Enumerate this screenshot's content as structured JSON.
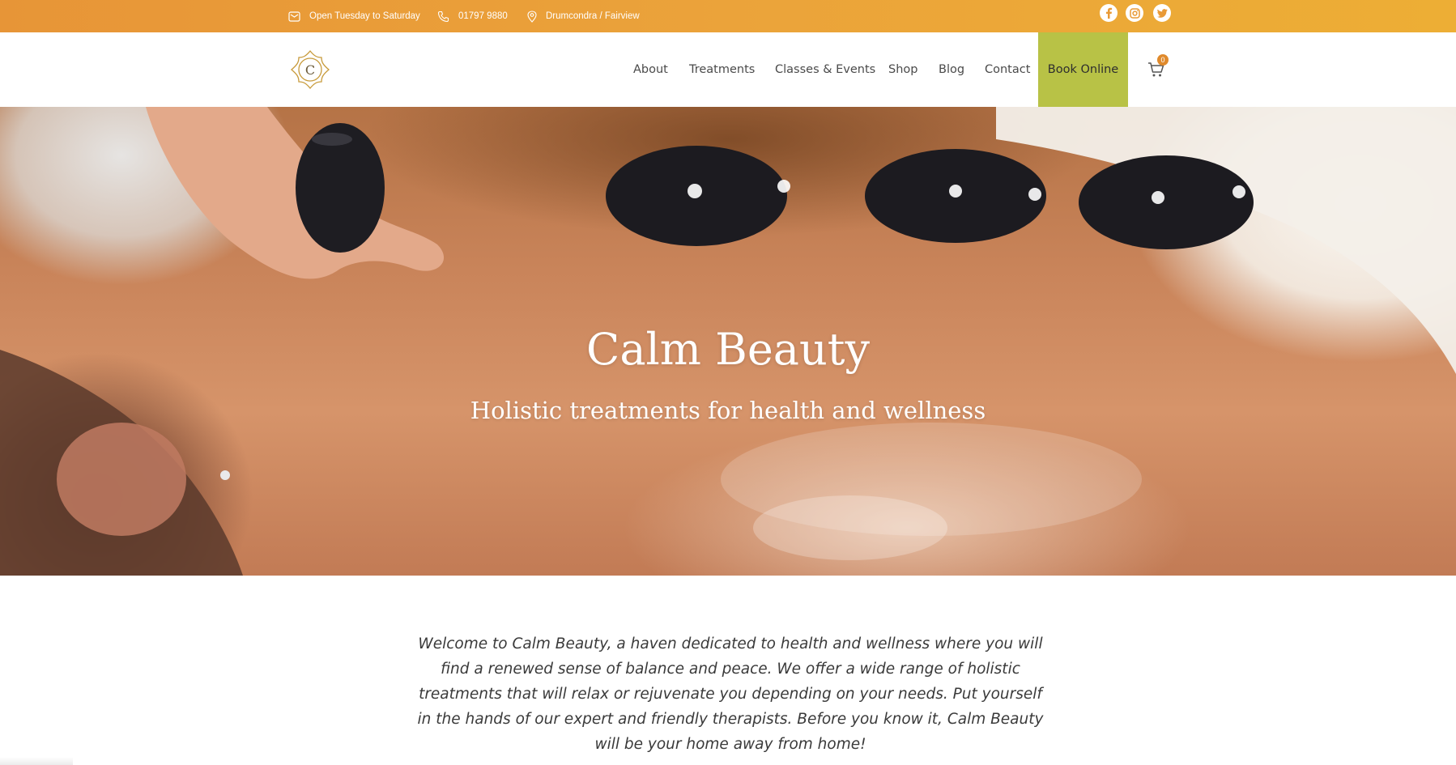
{
  "topbar": {
    "hours": "Open Tuesday to Saturday",
    "phone": "01797 9880",
    "location": "Drumcondra / Fairview",
    "social": [
      "facebook-icon",
      "instagram-icon",
      "twitter-icon"
    ]
  },
  "header": {
    "logo_letter": "C",
    "nav": {
      "about": "About",
      "treatments": "Treatments",
      "classes": "Classes & Events",
      "shop": "Shop",
      "blog": "Blog",
      "contact": "Contact",
      "book": "Book Online"
    },
    "cart_count": "0"
  },
  "hero": {
    "title": "Calm Beauty",
    "subtitle": "Holistic treatments for health and wellness"
  },
  "intro": {
    "text": "Welcome to Calm Beauty, a haven dedicated to health and wellness where you will find a renewed sense of balance and peace. We offer a wide range of holistic treatments that will relax or rejuvenate you depending on your needs. Put yourself in the hands of our expert and friendly therapists. Before you know it, Calm Beauty will be your home away from home!"
  },
  "colors": {
    "topbar_start": "#e79537",
    "topbar_end": "#edae35",
    "book_online_bg": "#b8c246",
    "logo_gold": "#c79a3a",
    "cart_badge": "#e08a2c"
  }
}
